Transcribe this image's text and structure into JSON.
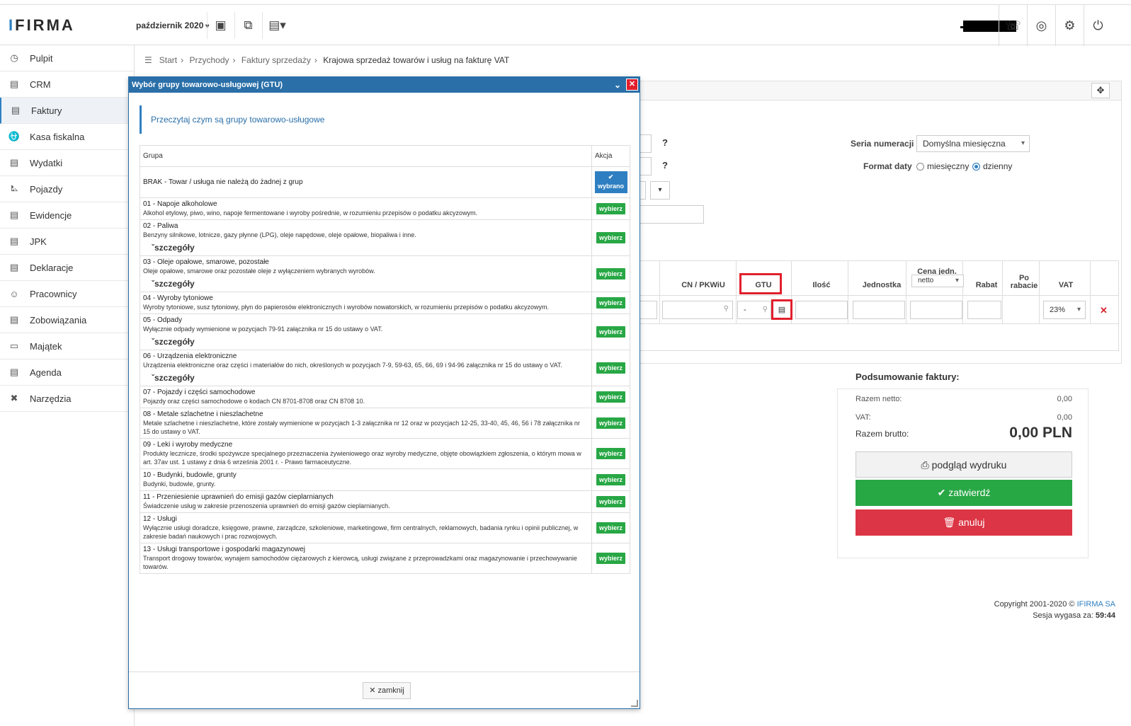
{
  "app": {
    "logo": "IFIRMA",
    "period": "październik 2020"
  },
  "sidebar": {
    "items": [
      {
        "label": "Pulpit",
        "icon": "dashboard-icon"
      },
      {
        "label": "CRM",
        "icon": "crm-icon"
      },
      {
        "label": "Faktury",
        "icon": "invoice-icon",
        "active": true
      },
      {
        "label": "Kasa fiskalna",
        "icon": "register-icon"
      },
      {
        "label": "Wydatki",
        "icon": "expenses-icon"
      },
      {
        "label": "Pojazdy",
        "icon": "car-icon"
      },
      {
        "label": "Ewidencje",
        "icon": "records-icon"
      },
      {
        "label": "JPK",
        "icon": "jpk-icon"
      },
      {
        "label": "Deklaracje",
        "icon": "declarations-icon"
      },
      {
        "label": "Pracownicy",
        "icon": "employees-icon"
      },
      {
        "label": "Zobowiązania",
        "icon": "liabilities-icon"
      },
      {
        "label": "Majątek",
        "icon": "assets-icon"
      },
      {
        "label": "Agenda",
        "icon": "agenda-icon"
      },
      {
        "label": "Narzędzia",
        "icon": "tools-icon"
      }
    ]
  },
  "breadcrumb": {
    "items": [
      "Start",
      "Przychody",
      "Faktury sprzedaży"
    ],
    "current": "Krajowa sprzedaż towarów i usług na fakturę VAT"
  },
  "form": {
    "seria_label": "Seria numeracji",
    "seria_value": "Domyślna miesięczna",
    "format_label": "Format daty",
    "format_opt1": "miesięczny",
    "format_opt2": "dzienny",
    "format_selected": "dzienny"
  },
  "grid": {
    "headers": {
      "cn": "CN / PKWiU",
      "gtu": "GTU",
      "ilosc": "Ilość",
      "jednostka": "Jednostka",
      "cena": "Cena jedn.",
      "cena_type": "netto",
      "rabat": "Rabat",
      "po_rabacie": "Po rabacie",
      "vat": "VAT"
    },
    "gtu_value": "-",
    "vat_value": "23%"
  },
  "summary": {
    "title": "Podsumowanie faktury:",
    "netto_label": "Razem netto:",
    "netto_value": "0,00",
    "vat_label": "VAT:",
    "vat_value": "0,00",
    "brutto_label": "Razem brutto:",
    "brutto_value": "0,00 PLN",
    "preview_btn": "podgląd wydruku",
    "confirm_btn": "zatwierdź",
    "cancel_btn": "anuluj"
  },
  "footer": {
    "copyright": "Copyright 2001-2020 ©",
    "company": "IFIRMA SA",
    "session_label": "Sesja wygasa za:",
    "session_value": "59:44"
  },
  "modal": {
    "title": "Wybór grupy towarowo-usługowej (GTU)",
    "info": "Przeczytaj czym są grupy towarowo-usługowe",
    "col_group": "Grupa",
    "col_action": "Akcja",
    "selected_label": "wybrano",
    "select_label": "wybierz",
    "details_label": "szczegóły",
    "close_btn": "zamknij",
    "rows": [
      {
        "name": "BRAK - Towar / usługa nie należą do żadnej z grup",
        "desc": "",
        "details": false,
        "selected": true
      },
      {
        "name": "01 - Napoje alkoholowe",
        "desc": "Alkohol etylowy, piwo, wino, napoje fermentowane i wyroby pośrednie, w rozumieniu przepisów o podatku akcyzowym.",
        "details": false,
        "selected": false
      },
      {
        "name": "02 - Paliwa",
        "desc": "Benzyny silnikowe, lotnicze, gazy płynne (LPG), oleje napędowe, oleje opałowe, biopaliwa i inne.",
        "details": true,
        "selected": false
      },
      {
        "name": "03 - Oleje opałowe, smarowe, pozostałe",
        "desc": "Oleje opałowe, smarowe oraz pozostałe oleje z wyłączeniem wybranych wyrobów.",
        "details": true,
        "selected": false
      },
      {
        "name": "04 - Wyroby tytoniowe",
        "desc": "Wyroby tytoniowe, susz tytoniowy, płyn do papierosów elektronicznych i wyrobów nowatorskich, w rozumieniu przepisów o podatku akcyzowym.",
        "details": false,
        "selected": false
      },
      {
        "name": "05 - Odpady",
        "desc": "Wyłącznie odpady wymienione w pozycjach 79-91 załącznika nr 15 do ustawy o VAT.",
        "details": true,
        "selected": false
      },
      {
        "name": "06 - Urządzenia elektroniczne",
        "desc": "Urządzenia elektroniczne oraz części i materiałów do nich, określonych w pozycjach 7-9, 59-63, 65, 66, 69 i 94-96 załącznika nr 15 do ustawy o VAT.",
        "details": true,
        "selected": false
      },
      {
        "name": "07 - Pojazdy i części samochodowe",
        "desc": "Pojazdy oraz części samochodowe o kodach CN 8701-8708 oraz CN 8708 10.",
        "details": false,
        "selected": false
      },
      {
        "name": "08 - Metale szlachetne i nieszlachetne",
        "desc": "Metale szlachetne i nieszlachetne, które zostały wymienione w pozycjach 1-3 załącznika nr 12 oraz w pozycjach 12-25, 33-40, 45, 46, 56 i 78 załącznika nr 15 do ustawy o VAT.",
        "details": false,
        "selected": false
      },
      {
        "name": "09 - Leki i wyroby medyczne",
        "desc": "Produkty lecznicze, środki spożywcze specjalnego przeznaczenia żywieniowego oraz wyroby medyczne, objęte obowiązkiem zgłoszenia, o którym mowa w art. 37av ust. 1 ustawy z dnia 6 września 2001 r. - Prawo farmaceutyczne.",
        "details": false,
        "selected": false
      },
      {
        "name": "10 - Budynki, budowle, grunty",
        "desc": "Budynki, budowle, grunty.",
        "details": false,
        "selected": false
      },
      {
        "name": "11 - Przeniesienie uprawnień do emisji gazów cieplarnianych",
        "desc": "Świadczenie usług w zakresie przenoszenia uprawnień do emisji gazów cieplarnianych.",
        "details": false,
        "selected": false
      },
      {
        "name": "12 - Usługi",
        "desc": "Wyłącznie usługi doradcze, księgowe, prawne, zarządcze, szkoleniowe, marketingowe, firm centralnych, reklamowych, badania rynku i opinii publicznej, w zakresie badań naukowych i prac rozwojowych.",
        "details": false,
        "selected": false
      },
      {
        "name": "13 - Usługi transportowe i gospodarki magazynowej",
        "desc": "Transport drogowy towarów, wynajem samochodów ciężarowych z kierowcą, usługi związane z przeprowadzkami oraz magazynowanie i przechowywanie towarów.",
        "details": false,
        "selected": false
      }
    ]
  }
}
